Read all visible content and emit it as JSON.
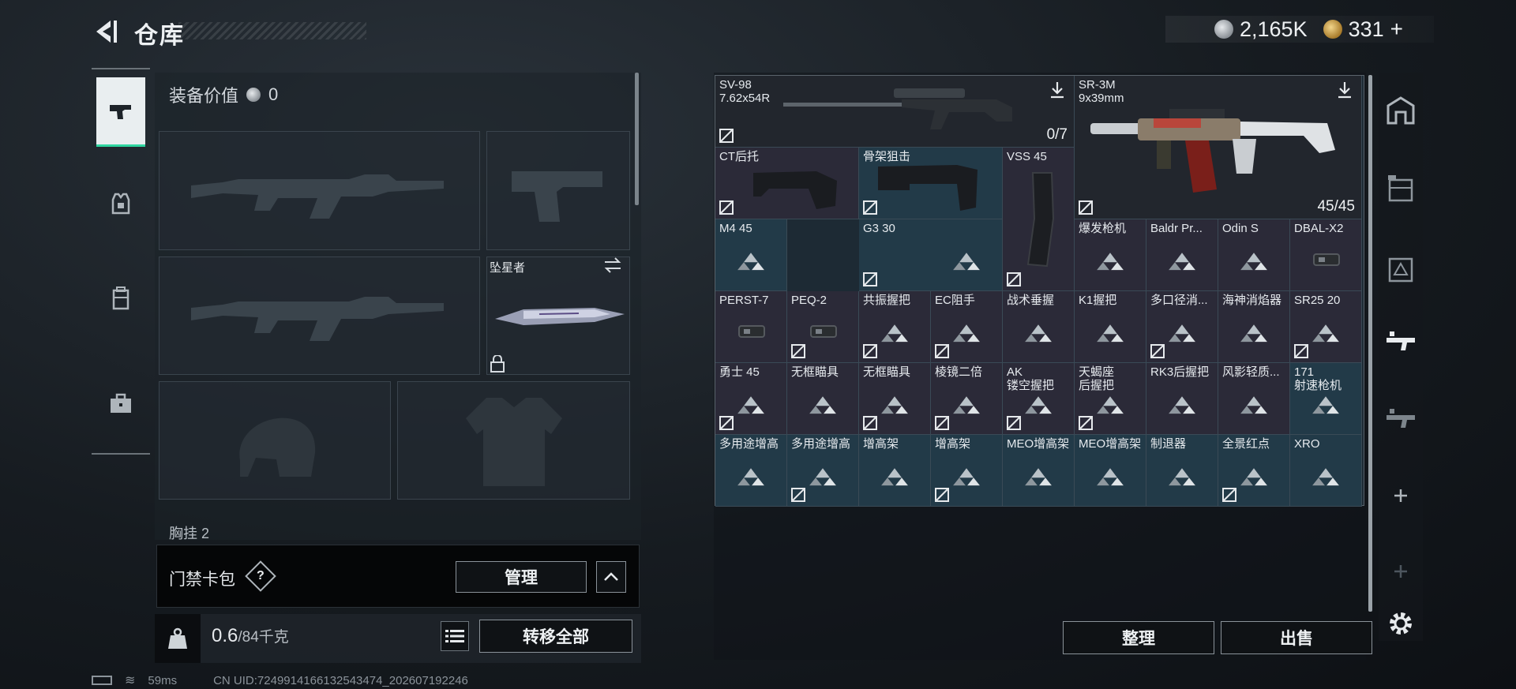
{
  "header": {
    "title": "仓库",
    "currency_silver": "2,165K",
    "currency_gold": "331",
    "plus_label": "+"
  },
  "equipment": {
    "value_label": "装备价值",
    "value": "0",
    "melee_name": "坠星者",
    "chest_label": "胸挂 2"
  },
  "keycard": {
    "label": "门禁卡包",
    "help": "?",
    "manage_label": "管理"
  },
  "weight": {
    "current": "0.6",
    "max": "/84千克"
  },
  "actions": {
    "transfer_all": "转移全部",
    "sort": "整理",
    "sell": "出售"
  },
  "status": {
    "ping": "59ms",
    "uid": "CN UID:7249914166132543474_202607192246"
  },
  "inventory": {
    "sv98": {
      "name": "SV-98\n7.62x54R",
      "count": "0/7"
    },
    "sr3m": {
      "name": "SR-3M\n9x39mm",
      "count": "45/45"
    },
    "vss": {
      "name": "VSS 45"
    },
    "cells": [
      {
        "name": "CT后托"
      },
      {
        "name": "骨架狙击"
      },
      {
        "name": "M4 45"
      },
      {
        "name": "G3 30"
      },
      {
        "name": "爆发枪机"
      },
      {
        "name": "Baldr Pr..."
      },
      {
        "name": "Odin S"
      },
      {
        "name": "DBAL-X2"
      },
      {
        "name": "PERST-7"
      },
      {
        "name": "PEQ-2"
      },
      {
        "name": "共振握把"
      },
      {
        "name": "EC阻手"
      },
      {
        "name": "战术垂握"
      },
      {
        "name": "K1握把"
      },
      {
        "name": "多口径消..."
      },
      {
        "name": "海神消焰器"
      },
      {
        "name": "SR25 20"
      },
      {
        "name": "勇士 45"
      },
      {
        "name": "无框瞄具"
      },
      {
        "name": "无框瞄具"
      },
      {
        "name": "棱镜二倍"
      },
      {
        "name": "AK\n镂空握把"
      },
      {
        "name": "天蝎座\n后握把"
      },
      {
        "name": "RK3后握把"
      },
      {
        "name": "风影轻质..."
      },
      {
        "name": "171\n射速枪机"
      },
      {
        "name": "多用途增高"
      },
      {
        "name": "多用途增高"
      },
      {
        "name": "增高架"
      },
      {
        "name": "增高架"
      },
      {
        "name": "MEO增高架"
      },
      {
        "name": "MEO增高架"
      },
      {
        "name": "制退器"
      },
      {
        "name": "全景红点"
      },
      {
        "name": "XRO"
      }
    ]
  },
  "colors": {
    "accent": "#2fd6a0",
    "teal_cell": "#223a48",
    "purple_cell": "#2b2a38"
  }
}
